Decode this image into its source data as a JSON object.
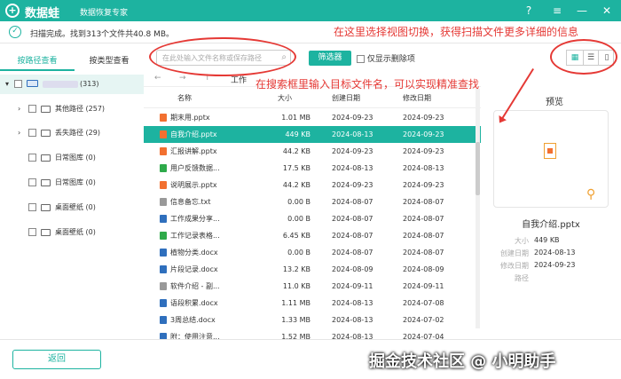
{
  "app": {
    "name": "数据蛙",
    "subtitle": "数据恢复专家",
    "logo_glyph": "+"
  },
  "titlebar": {
    "help_glyph": "?",
    "menu_glyph": "≡",
    "min_glyph": "—",
    "close_glyph": "✕"
  },
  "status": {
    "check_glyph": "✓",
    "text": "扫描完成。找到313个文件共40.8 MB。"
  },
  "tabs": [
    {
      "label": "按路径查看"
    },
    {
      "label": "按类型查看"
    }
  ],
  "search": {
    "placeholder": "在此处输入文件名称或保存路径",
    "icon_glyph": "⌕"
  },
  "filter": {
    "label": "筛选器"
  },
  "only_deleted": {
    "label": "仅显示删除项"
  },
  "view_toggle": {
    "grid_glyph": "▦",
    "list_glyph": "☰",
    "detail_glyph": "▯"
  },
  "tree": [
    {
      "label": "(313)",
      "expand": "▾"
    },
    {
      "label": "其他路径 (257)",
      "expand": "›"
    },
    {
      "label": "丢失路径 (29)",
      "expand": "›"
    },
    {
      "label": "日常图库 (0)",
      "expand": ""
    },
    {
      "label": "日常图库 (0)",
      "expand": ""
    },
    {
      "label": "桌面壁纸 (0)",
      "expand": ""
    },
    {
      "label": "桌面壁纸 (0)",
      "expand": ""
    }
  ],
  "nav": {
    "back": "←",
    "forward": "→",
    "up": "↑",
    "path": "工作"
  },
  "table": {
    "headers": {
      "name": "名称",
      "size": "大小",
      "created": "创建日期",
      "modified": "修改日期"
    },
    "rows": [
      {
        "name": "期末用.pptx",
        "size": "1.01 MB",
        "created": "2024-09-23",
        "modified": "2024-09-23",
        "color": "#f27030"
      },
      {
        "name": "自我介绍.pptx",
        "size": "449 KB",
        "created": "2024-08-13",
        "modified": "2024-09-23",
        "color": "#f27030"
      },
      {
        "name": "汇报讲解.pptx",
        "size": "44.2 KB",
        "created": "2024-09-23",
        "modified": "2024-09-23",
        "color": "#f27030"
      },
      {
        "name": "用户反馈数据...",
        "size": "17.5 KB",
        "created": "2024-08-13",
        "modified": "2024-08-13",
        "color": "#2eaa4a"
      },
      {
        "name": "说明展示.pptx",
        "size": "44.2 KB",
        "created": "2024-09-23",
        "modified": "2024-09-23",
        "color": "#f27030"
      },
      {
        "name": "信息备忘.txt",
        "size": "0.00 B",
        "created": "2024-08-07",
        "modified": "2024-08-07",
        "color": "#999999"
      },
      {
        "name": "工作成果分享...",
        "size": "0.00 B",
        "created": "2024-08-07",
        "modified": "2024-08-07",
        "color": "#2f6fbd"
      },
      {
        "name": "工作记录表格...",
        "size": "6.45 KB",
        "created": "2024-08-07",
        "modified": "2024-08-07",
        "color": "#2eaa4a"
      },
      {
        "name": "植物分类.docx",
        "size": "0.00 B",
        "created": "2024-08-07",
        "modified": "2024-08-07",
        "color": "#2f6fbd"
      },
      {
        "name": "片段记录.docx",
        "size": "13.2 KB",
        "created": "2024-08-09",
        "modified": "2024-08-09",
        "color": "#2f6fbd"
      },
      {
        "name": "软件介绍 - 副...",
        "size": "11.0 KB",
        "created": "2024-09-11",
        "modified": "2024-09-11",
        "color": "#999999"
      },
      {
        "name": "语段积累.docx",
        "size": "1.11 MB",
        "created": "2024-08-13",
        "modified": "2024-07-08",
        "color": "#2f6fbd"
      },
      {
        "name": "3周总结.docx",
        "size": "1.33 MB",
        "created": "2024-08-13",
        "modified": "2024-07-02",
        "color": "#2f6fbd"
      },
      {
        "name": "附：使用注意...",
        "size": "1.52 MB",
        "created": "2024-08-13",
        "modified": "2024-07-04",
        "color": "#2f6fbd"
      }
    ]
  },
  "preview": {
    "title": "预览",
    "zoom_glyph": "⚲",
    "filename": "自我介绍.pptx",
    "meta": [
      {
        "key": "大小",
        "value": "449 KB"
      },
      {
        "key": "创建日期",
        "value": "2024-08-13"
      },
      {
        "key": "修改日期",
        "value": "2024-09-23"
      },
      {
        "key": "路径",
        "value": ""
      }
    ]
  },
  "footer": {
    "back_label": "返回",
    "watermark": "掘金技术社区 @ 小明助手"
  },
  "annotations": {
    "view_switch": "在这里选择视图切换，获得扫描文件更多详细的信息",
    "search_tip": "在搜索框里输入目标文件名，可以实现精准查找"
  },
  "colors": {
    "accent": "#1db3a0",
    "annotation": "#e53935"
  }
}
